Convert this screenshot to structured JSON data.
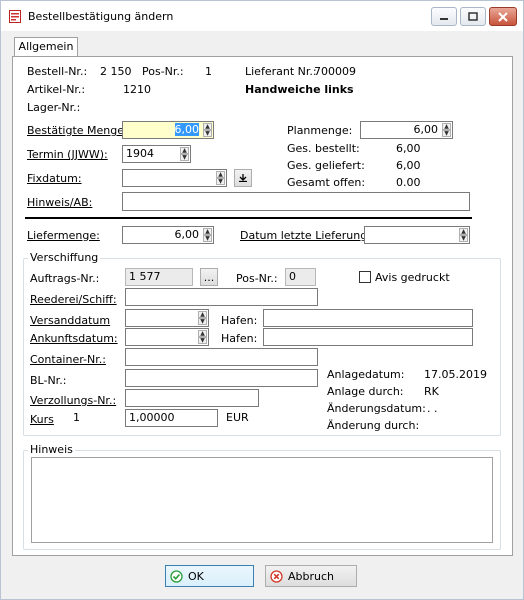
{
  "window": {
    "title": "Bestellbestätigung ändern"
  },
  "tab": {
    "label": "Allgemein"
  },
  "header": {
    "bestell_label": "Bestell-Nr.:",
    "bestell_value": "2 150",
    "pos_label": "Pos-Nr.:",
    "pos_value": "1",
    "lieferant_label": "Lieferant Nr.:",
    "lieferant_value": "700009",
    "artikel_label": "Artikel-Nr.:",
    "artikel_value": "1210",
    "artikel_name": "Handweiche links",
    "lager_label": "Lager-Nr.:"
  },
  "form": {
    "menge_label": "Bestätigte Menge:",
    "menge_value": "6,00",
    "termin_label": "Termin (JJWW):",
    "termin_value": "1904",
    "fixdatum_label": "Fixdatum:",
    "fixdatum_value": "",
    "hinweis_ab_label": "Hinweis/AB:",
    "hinweis_ab_value": "",
    "liefermenge_label": "Liefermenge:",
    "liefermenge_value": "6,00",
    "datum_letzte_label": "Datum letzte Lieferung:",
    "datum_letzte_value": ""
  },
  "summary": {
    "planmenge_label": "Planmenge:",
    "planmenge_value": "6,00",
    "bestellt_label": "Ges. bestellt:",
    "bestellt_value": "6,00",
    "geliefert_label": "Ges. geliefert:",
    "geliefert_value": "6,00",
    "offen_label": "Gesamt offen:",
    "offen_value": "0.00"
  },
  "verschiffung": {
    "title": "Verschiffung",
    "auftrags_label": "Auftrags-Nr.:",
    "auftrags_value": "1 577",
    "browse_label": "...",
    "pos_label": "Pos-Nr.:",
    "pos_value": "0",
    "avis_label": "Avis gedruckt",
    "avis_checked": false,
    "reederei_label": "Reederei/Schiff:",
    "reederei_value": "",
    "versand_label": "Versanddatum",
    "versand_value": "",
    "hafen1_label": "Hafen:",
    "hafen1_value": "",
    "ankunft_label": "Ankunftsdatum:",
    "ankunft_value": "",
    "hafen2_label": "Hafen:",
    "hafen2_value": "",
    "container_label": "Container-Nr.:",
    "container_value": "",
    "bl_label": "BL-Nr.:",
    "bl_value": "",
    "verzoll_label": "Verzollungs-Nr.:",
    "verzoll_value": "",
    "kurs_label": "Kurs",
    "kurs_num": "1",
    "kurs_value": "1,00000",
    "currency": "EUR",
    "anlagedatum_label": "Anlagedatum:",
    "anlagedatum_value": "17.05.2019",
    "anlage_durch_label": "Anlage durch:",
    "anlage_durch_value": "RK",
    "aenderungsdatum_label": "Änderungsdatum:",
    "aenderungsdatum_value": ". .",
    "aenderung_durch_label": "Änderung durch:",
    "aenderung_durch_value": ""
  },
  "hinweis": {
    "title": "Hinweis",
    "value": ""
  },
  "buttons": {
    "ok": "OK",
    "cancel": "Abbruch"
  },
  "colors": {
    "highlight": "#ffffcc",
    "selection": "#3399ff"
  }
}
